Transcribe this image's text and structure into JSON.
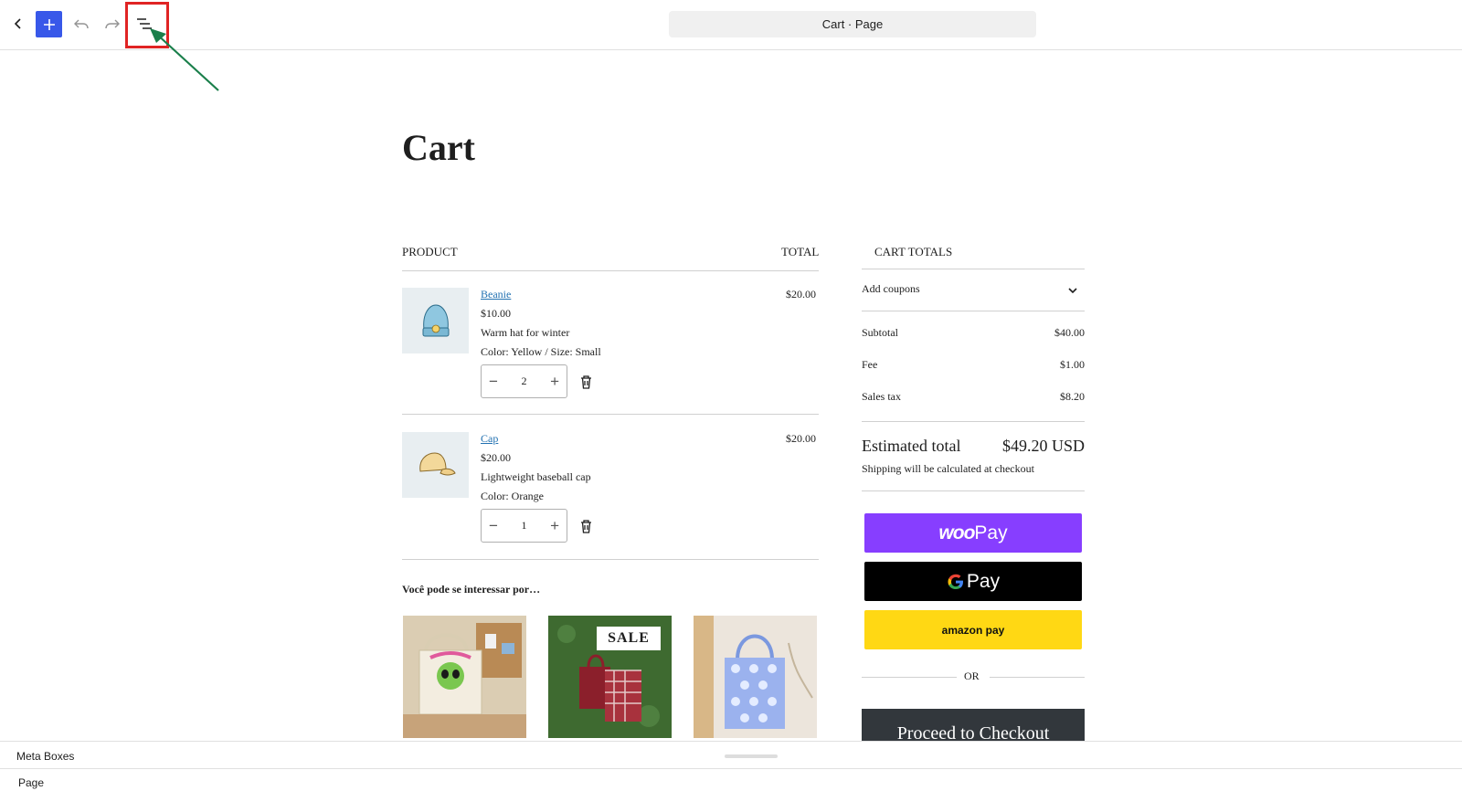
{
  "toolbar": {
    "back_icon": "chevron-left-icon",
    "add_icon": "plus-icon",
    "undo_icon": "undo-icon",
    "redo_icon": "redo-icon",
    "list_view_icon": "list-view-icon",
    "document_title": "Cart · Page",
    "accent_color": "#3858e9",
    "highlight_color": "#e02424",
    "arrow_color": "#1a7f4b"
  },
  "page": {
    "title": "Cart"
  },
  "cart": {
    "product_header": "PRODUCT",
    "total_header": "TOTAL",
    "items": [
      {
        "name": "Beanie",
        "price": "$10.00",
        "description": "Warm hat for winter",
        "attributes": "Color: Yellow / Size: Small",
        "quantity": "2",
        "total": "$20.00",
        "image_icon": "beanie-image"
      },
      {
        "name": "Cap",
        "price": "$20.00",
        "description": "Lightweight baseball cap",
        "attributes": "Color: Orange",
        "quantity": "1",
        "total": "$20.00",
        "image_icon": "cap-image"
      }
    ],
    "minus_symbol": "−",
    "plus_symbol": "+"
  },
  "recommendations": {
    "title": "Você pode se interessar por…",
    "items": [
      {
        "image_icon": "tote-bag-alien-image"
      },
      {
        "image_icon": "tote-bag-sale-image",
        "badge": "SALE"
      },
      {
        "image_icon": "tote-bag-blue-image"
      }
    ]
  },
  "totals": {
    "title": "CART TOTALS",
    "coupons_label": "Add coupons",
    "rows": [
      {
        "label": "Subtotal",
        "value": "$40.00"
      },
      {
        "label": "Fee",
        "value": "$1.00"
      },
      {
        "label": "Sales tax",
        "value": "$8.20"
      }
    ],
    "estimated_label": "Estimated total",
    "estimated_value": "$49.20 USD",
    "shipping_note": "Shipping will be calculated at checkout",
    "woopay_brand": "woo",
    "woopay_suffix": "Pay",
    "gpay_suffix": "Pay",
    "amazon_label": "amazon pay",
    "or_label": "OR",
    "checkout_label": "Proceed to Checkout"
  },
  "meta_boxes": {
    "title": "Meta Boxes",
    "page_label": "Page"
  }
}
